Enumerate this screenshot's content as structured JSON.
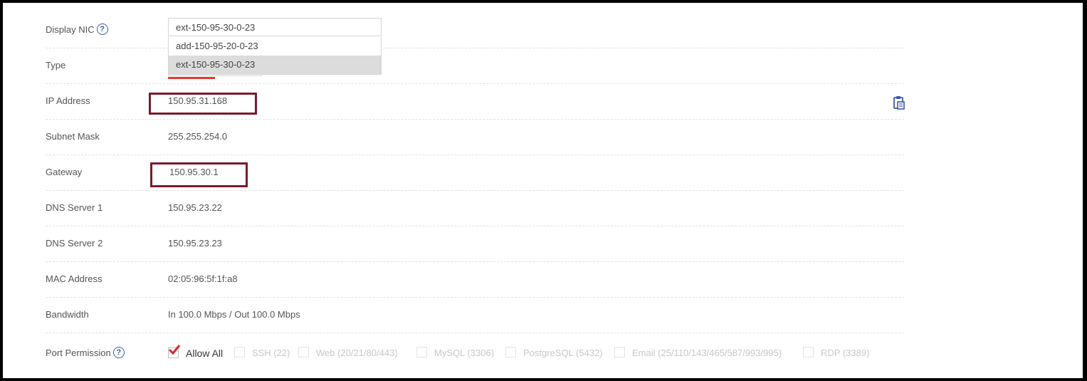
{
  "fields": {
    "display_nic_label": "Display NIC",
    "type_label": "Type",
    "ip_label": "IP Address",
    "ip_value": "150.95.31.168",
    "subnet_label": "Subnet Mask",
    "subnet_value": "255.255.254.0",
    "gateway_label": "Gateway",
    "gateway_value": "150.95.30.1",
    "dns1_label": "DNS Server 1",
    "dns1_value": "150.95.23.22",
    "dns2_label": "DNS Server 2",
    "dns2_value": "150.95.23.23",
    "mac_label": "MAC Address",
    "mac_value": "02:05:96:5f:1f:a8",
    "bandwidth_label": "Bandwidth",
    "bandwidth_value": "In 100.0 Mbps / Out 100.0 Mbps",
    "port_label": "Port Permission"
  },
  "nic_select": {
    "current": "ext-150-95-30-0-23",
    "options": [
      "add-150-95-20-0-23",
      "ext-150-95-30-0-23"
    ],
    "selected_index": 1
  },
  "ports": [
    {
      "label": "Allow All",
      "checked": true
    },
    {
      "label": "SSH (22)",
      "checked": false
    },
    {
      "label": "Web (20/21/80/443)",
      "checked": false
    },
    {
      "label": "MySQL (3306)",
      "checked": false
    },
    {
      "label": "PostgreSQL (5432)",
      "checked": false
    },
    {
      "label": "Email (25/110/143/465/587/993/995)",
      "checked": false
    },
    {
      "label": "RDP (3389)",
      "checked": false
    }
  ],
  "colors": {
    "highlight_box": "#7a1a2b",
    "accent_underline": "#e23b2e",
    "help_icon": "#3a5ca8",
    "check_mark": "#d9262b"
  }
}
